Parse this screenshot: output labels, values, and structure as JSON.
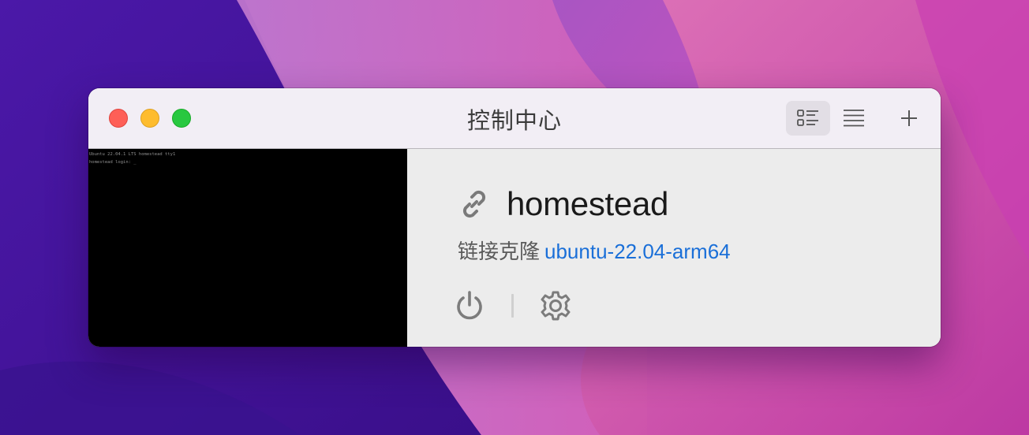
{
  "window": {
    "title": "控制中心"
  },
  "toolbar": {
    "grid_view_icon": "grid-list-icon",
    "list_view_icon": "list-icon",
    "add_icon": "plus-icon"
  },
  "terminal": {
    "lines": [
      "Ubuntu 22.04.1 LTS homestead tty1",
      "",
      "homestead login: _"
    ]
  },
  "vm": {
    "icon": "link-icon",
    "name": "homestead",
    "clone_label": "链接克隆",
    "clone_source": "ubuntu-22.04-arm64"
  },
  "actions": {
    "power_icon": "power-icon",
    "settings_icon": "gear-icon"
  },
  "colors": {
    "close": "#fe5f57",
    "minimize": "#febc2e",
    "zoom": "#28c840",
    "link": "#1a6fd8"
  }
}
